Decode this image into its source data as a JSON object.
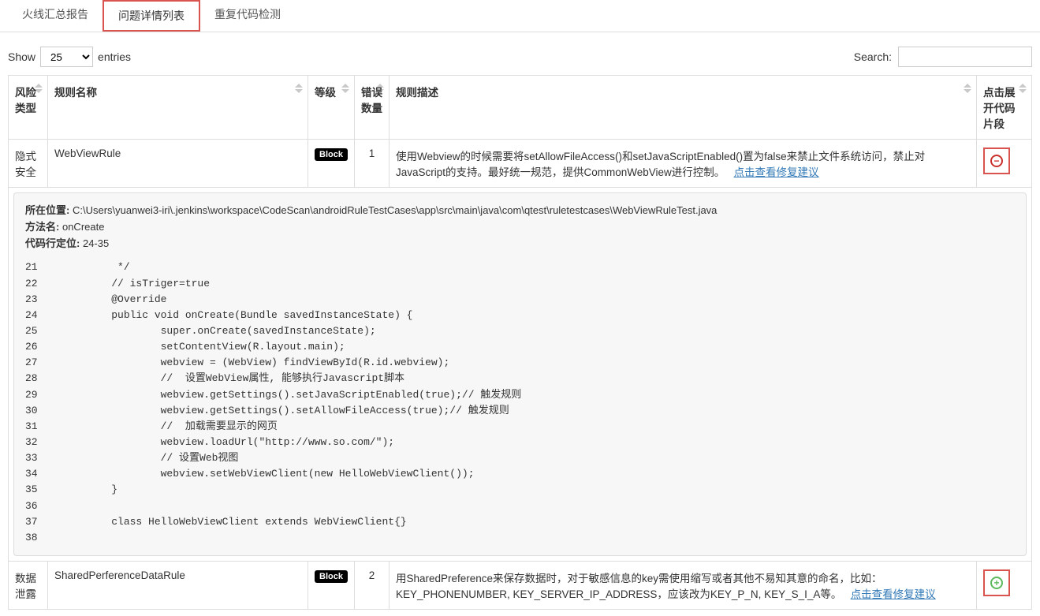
{
  "tabs": {
    "summary": "火线汇总报告",
    "details": "问题详情列表",
    "duplicate": "重复代码检测"
  },
  "controls": {
    "show_label": "Show",
    "entries_label": "entries",
    "page_size": "25",
    "search_label": "Search:",
    "search_value": ""
  },
  "headers": {
    "risk": "风险类型",
    "rule_name": "规则名称",
    "level": "等级",
    "errors": "错误数量",
    "desc": "规则描述",
    "expand": "点击展开代码片段"
  },
  "link_text": "点击查看修复建议",
  "rows": [
    {
      "risk": "隐式安全",
      "rule_name": "WebViewRule",
      "level": "Block",
      "errors": "1",
      "desc": "使用Webview的时候需要将setAllowFileAccess()和setJavaScriptEnabled()置为false来禁止文件系统访问，禁止对JavaScript的支持。最好统一规范，提供CommonWebView进行控制。",
      "expanded": true
    },
    {
      "risk": "数据泄露",
      "rule_name": "SharedPerferenceDataRule",
      "level": "Block",
      "errors": "2",
      "desc": "用SharedPreference来保存数据时，对于敏感信息的key需使用缩写或者其他不易知其意的命名，比如：KEY_PHONENUMBER, KEY_SERVER_IP_ADDRESS，应该改为KEY_P_N, KEY_S_I_A等。",
      "expanded": false
    }
  ],
  "code_detail": {
    "location_label": "所在位置:",
    "location": "C:\\Users\\yuanwei3-iri\\.jenkins\\workspace\\CodeScan\\androidRuleTestCases\\app\\src\\main\\java\\com\\qtest\\ruletestcases\\WebViewRuleTest.java",
    "method_label": "方法名:",
    "method": "onCreate",
    "lines_label": "代码行定位:",
    "lines": "24-35",
    "code": "21             */\n22            // isTriger=true\n23            @Override\n24            public void onCreate(Bundle savedInstanceState) {\n25                    super.onCreate(savedInstanceState);\n26                    setContentView(R.layout.main);\n27                    webview = (WebView) findViewById(R.id.webview);\n28                    //  设置WebView属性, 能够执行Javascript脚本\n29                    webview.getSettings().setJavaScriptEnabled(true);// 触发规则\n30                    webview.getSettings().setAllowFileAccess(true);// 触发规则\n31                    //  加载需要显示的网页\n32                    webview.loadUrl(\"http://www.so.com/\");\n33                    // 设置Web视图\n34                    webview.setWebViewClient(new HelloWebViewClient());\n35            }\n36\n37            class HelloWebViewClient extends WebViewClient{}\n38"
  }
}
